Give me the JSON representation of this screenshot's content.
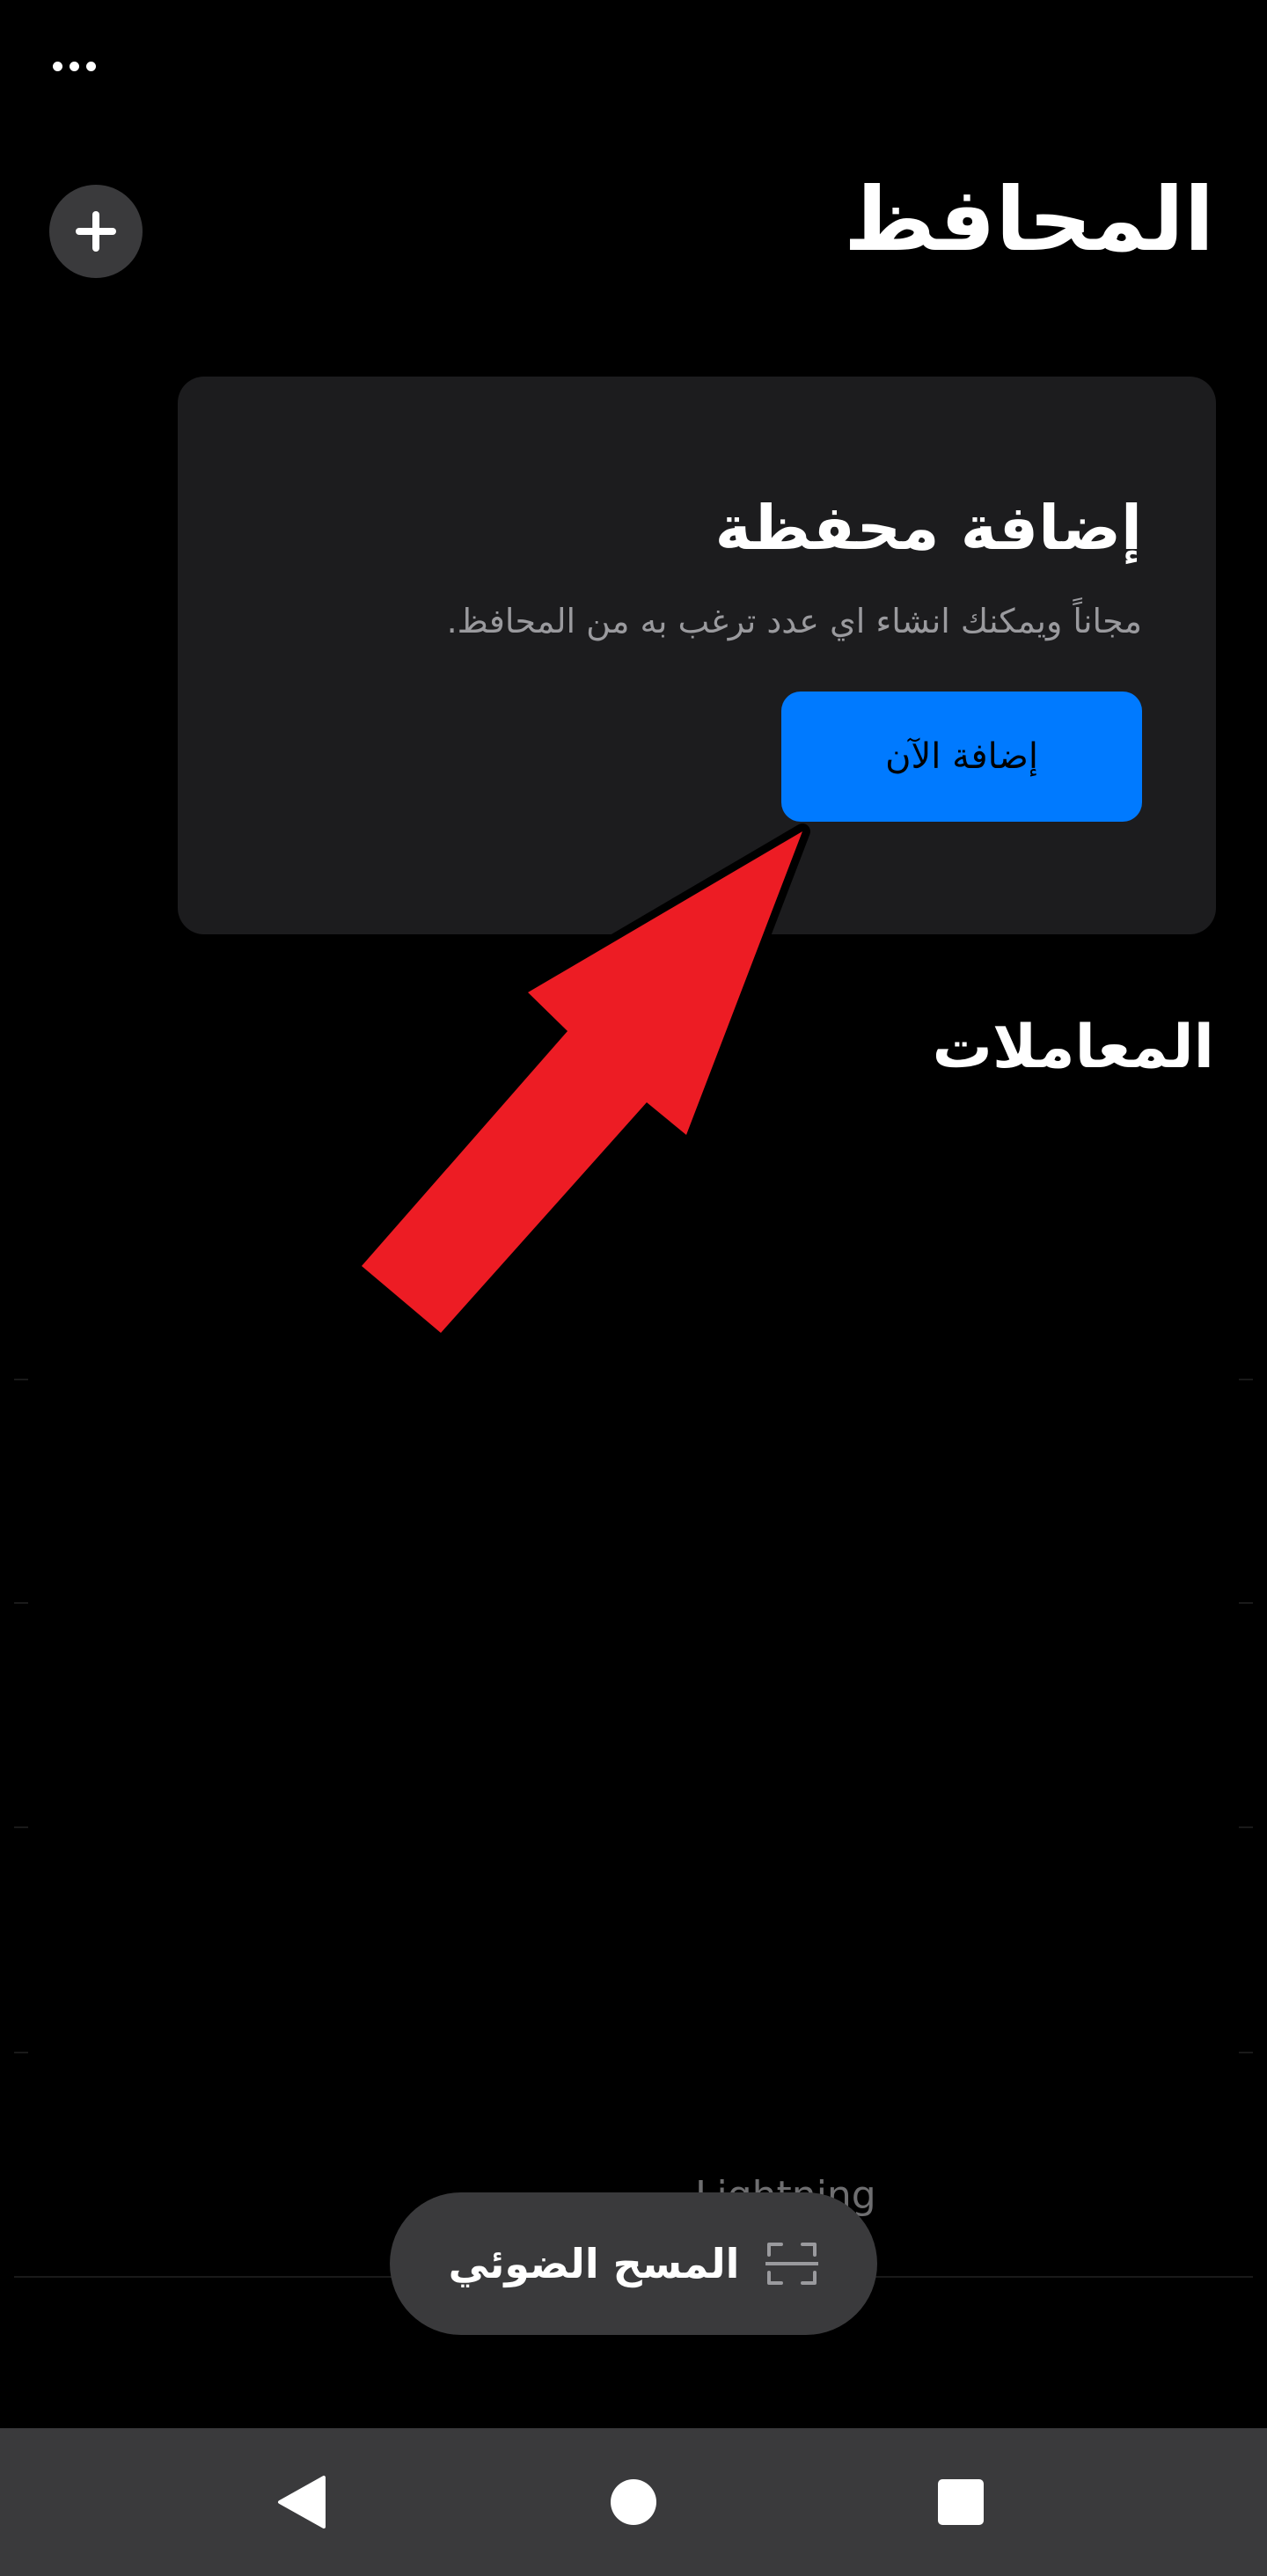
{
  "header": {
    "title": "المحافظ",
    "more_icon": "more-horizontal-icon",
    "add_icon": "plus-icon"
  },
  "add_wallet_card": {
    "title": "إضافة محفظة",
    "description": "مجاناً ويمكنك انشاء اي عدد ترغب به من المحافظ.",
    "button_label": "إضافة الآن",
    "button_color": "#007aff",
    "card_color": "#1c1c1e"
  },
  "transactions": {
    "title": "المعاملات",
    "hint_text": "Lightning"
  },
  "scan_button": {
    "label": "المسح الضوئي",
    "icon": "scan-icon"
  },
  "annotation": {
    "arrow_color": "#ed1c24"
  },
  "system_nav": {
    "back_icon": "back-triangle-icon",
    "home_icon": "home-circle-icon",
    "recents_icon": "recents-square-icon"
  }
}
